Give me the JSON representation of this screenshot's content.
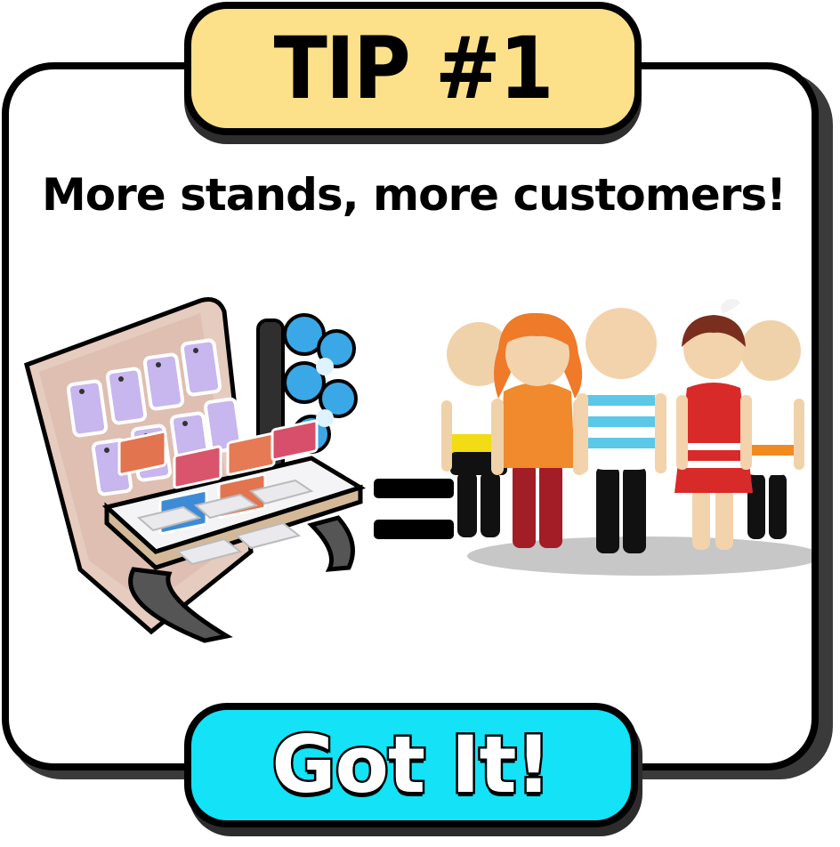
{
  "dialog": {
    "title": "TIP #1",
    "subtitle": "More stands, more customers!",
    "button_label": "Got It!"
  },
  "illustration": {
    "left_icon": "laptop-phone-stand",
    "operator_icon": "equals-icon",
    "right_icon": "customer-crowd",
    "customer_count": 5
  },
  "colors": {
    "title_tab": "#fde08a",
    "button": "#14e2f6",
    "panel": "#ffffff",
    "outline": "#000000"
  }
}
